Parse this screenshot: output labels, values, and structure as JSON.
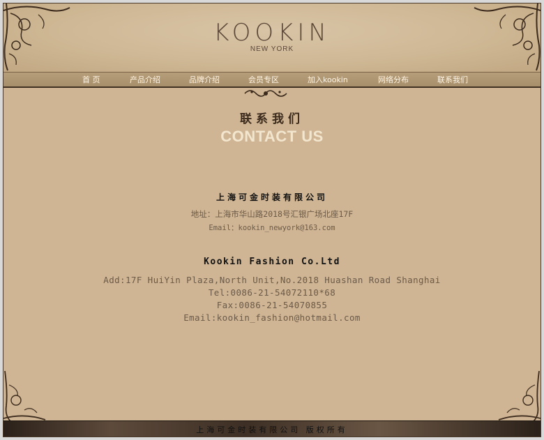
{
  "brand": {
    "logo": "KOOKIN",
    "subtitle": "NEW YORK"
  },
  "nav": {
    "items": [
      {
        "label": "首  页"
      },
      {
        "label": "产品介绍"
      },
      {
        "label": "品牌介绍"
      },
      {
        "label": "会员专区"
      },
      {
        "label": "加入kookin"
      },
      {
        "label": "网络分布"
      },
      {
        "label": "联系我们"
      }
    ]
  },
  "page": {
    "title_cn": "联系我们",
    "title_en": "CONTACT US"
  },
  "contact_cn": {
    "company": "上海可金时装有限公司",
    "address": "地址：上海市华山路2018号汇银广场北座17F",
    "email": "Email：kookin_newyork@163.com"
  },
  "contact_en": {
    "company": "Kookin Fashion Co.Ltd",
    "address": "Add:17F HuiYin Plaza,North Unit,No.2018 Huashan Road Shanghai",
    "tel": "Tel:0086-21-54072110*68",
    "fax": "Fax:0086-21-54070855",
    "email": "Email:kookin_fashion@hotmail.com"
  },
  "footer": {
    "text": "上海可金时装有限公司  版权所有"
  },
  "colors": {
    "background": "#cfb594",
    "nav": "#a88f6b",
    "accent_text": "#f3e6cf",
    "body_text": "#6b5a48",
    "footer": "#3d2f25"
  }
}
